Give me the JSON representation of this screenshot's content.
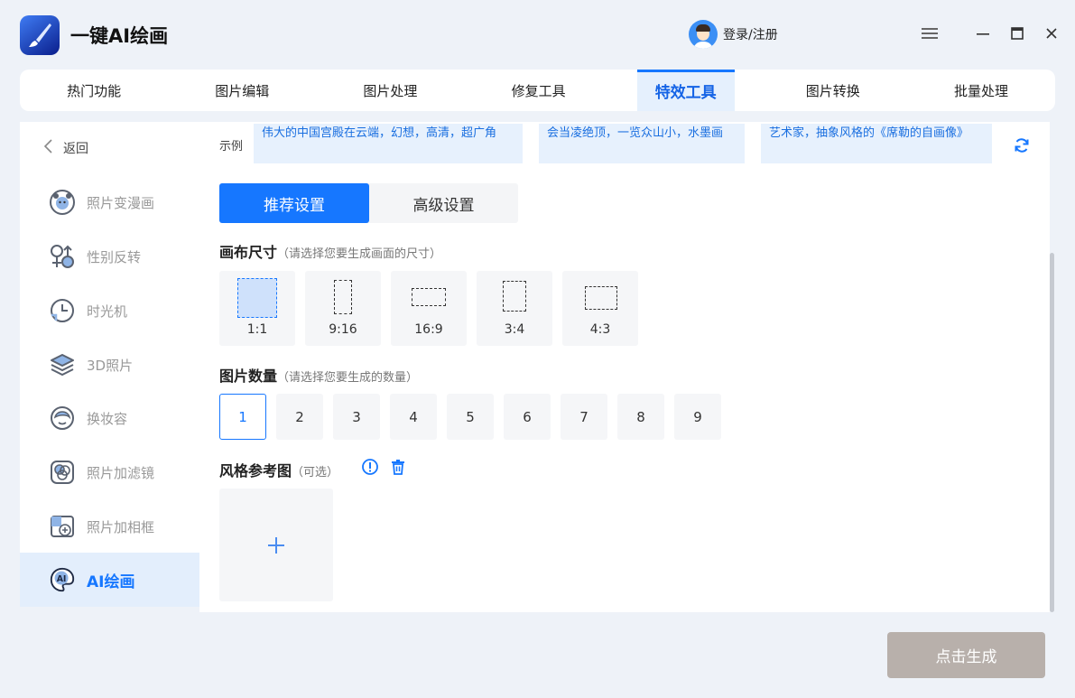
{
  "app": {
    "title": "一键AI绘画",
    "brand_color": "#1677ff",
    "logo_icon": "brush-logo-icon"
  },
  "user": {
    "login_label": "登录/注册",
    "avatar_icon": "user-avatar"
  },
  "window_controls": [
    "menu-icon",
    "minimize-icon",
    "maximize-icon",
    "close-icon"
  ],
  "tabs": [
    {
      "label": "热门功能"
    },
    {
      "label": "图片编辑"
    },
    {
      "label": "图片处理"
    },
    {
      "label": "修复工具"
    },
    {
      "label": "特效工具",
      "active": true
    },
    {
      "label": "图片转换"
    },
    {
      "label": "批量处理"
    }
  ],
  "sidebar": {
    "back_label": "返回",
    "items": [
      {
        "label": "照片变漫画",
        "icon": "bear-face-icon"
      },
      {
        "label": "性别反转",
        "icon": "gender-icon"
      },
      {
        "label": "时光机",
        "icon": "time-clock-icon"
      },
      {
        "label": "3D照片",
        "icon": "layers-icon"
      },
      {
        "label": "换妆容",
        "icon": "makeup-face-icon"
      },
      {
        "label": "照片加滤镜",
        "icon": "filter-icon"
      },
      {
        "label": "照片加相框",
        "icon": "frame-add-icon"
      },
      {
        "label": "AI绘画",
        "icon": "ai-palette-icon",
        "active": true
      }
    ]
  },
  "examples": {
    "label": "示例",
    "items": [
      "伟大的中国宫殿在云端，幻想，高清，超广角",
      "会当凌绝顶，一览众山小，水墨画",
      "艺术家，抽象风格的《席勒的自画像》"
    ]
  },
  "settings_tabs": {
    "recommended": "推荐设置",
    "advanced": "高级设置",
    "active": "recommended"
  },
  "canvas_size": {
    "title": "画布尺寸",
    "hint": "（请选择您要生成画面的尺寸）",
    "options": [
      "1:1",
      "9:16",
      "16:9",
      "3:4",
      "4:3"
    ],
    "selected": "1:1"
  },
  "image_count": {
    "title": "图片数量",
    "hint": "（请选择您要生成的数量）",
    "options": [
      "1",
      "2",
      "3",
      "4",
      "5",
      "6",
      "7",
      "8",
      "9"
    ],
    "selected": "1"
  },
  "style_reference": {
    "title": "风格参考图",
    "hint": "（可选）",
    "info_icon": "info-icon",
    "delete_icon": "trash-icon",
    "upload_icon": "plus-icon"
  },
  "generate_button": {
    "label": "点击生成",
    "color": "#b8b0ab"
  }
}
